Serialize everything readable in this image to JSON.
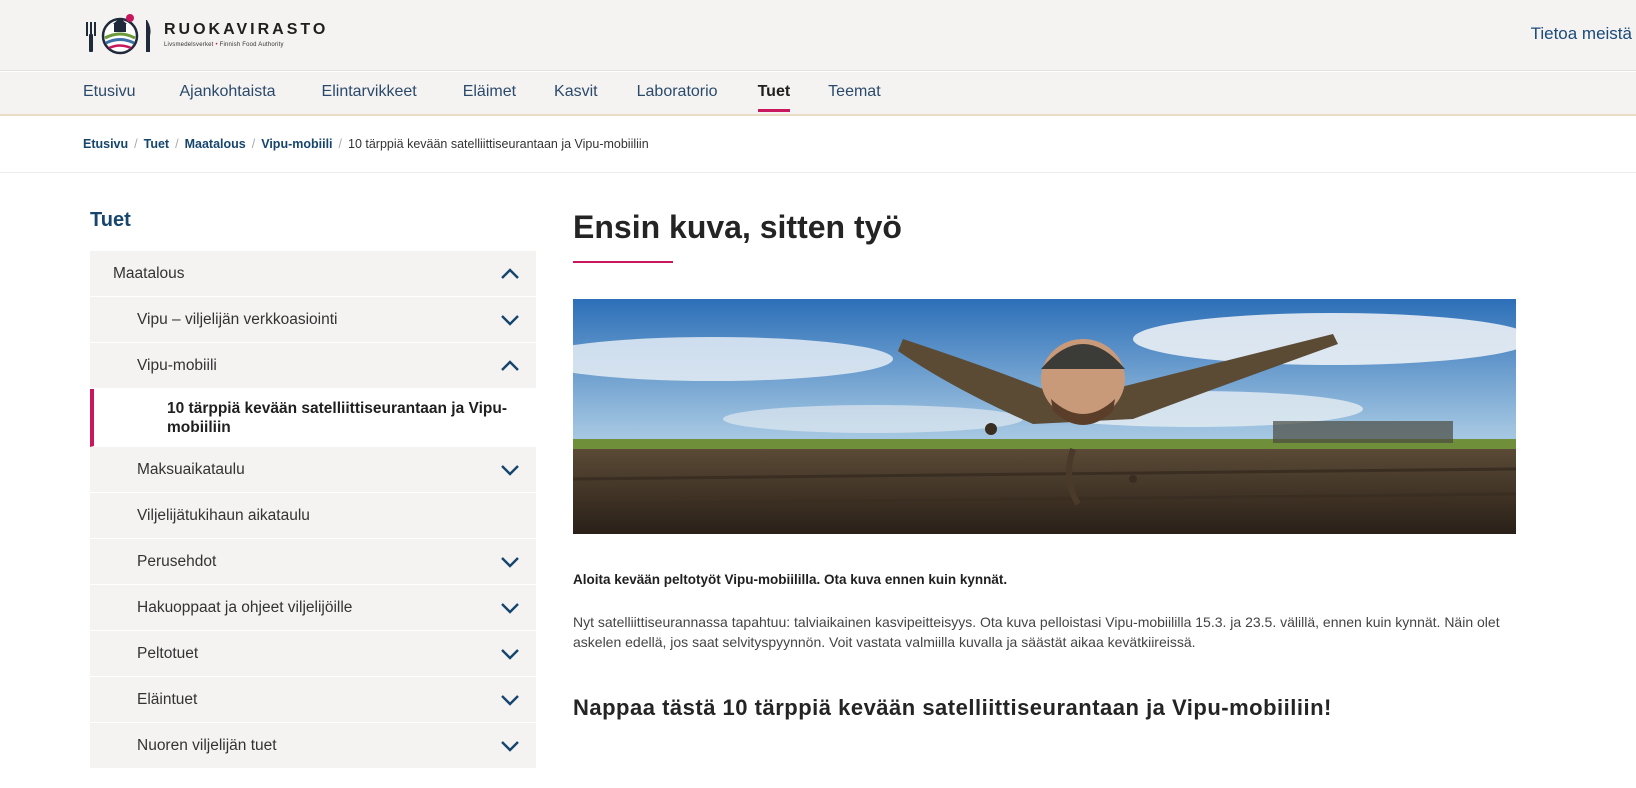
{
  "header": {
    "logo_name": "RUOKAVIRASTO",
    "logo_sub_a": "Livsmedelsverket",
    "logo_sub_b": "Finnish Food Authority",
    "top_link": "Tietoa meistä"
  },
  "nav": {
    "items": [
      {
        "label": "Etusivu",
        "active": false
      },
      {
        "label": "Ajankohtaista",
        "active": false
      },
      {
        "label": "Elintarvikkeet",
        "active": false
      },
      {
        "label": "Eläimet",
        "active": false
      },
      {
        "label": "Kasvit",
        "active": false
      },
      {
        "label": "Laboratorio",
        "active": false
      },
      {
        "label": "Tuet",
        "active": true
      },
      {
        "label": "Teemat",
        "active": false
      }
    ]
  },
  "breadcrumb": {
    "items": [
      "Etusivu",
      "Tuet",
      "Maatalous",
      "Vipu-mobiili"
    ],
    "current": "10 tärppiä kevään satelliittiseurantaan ja Vipu-mobiiliin"
  },
  "sidebar": {
    "title": "Tuet",
    "items": [
      {
        "label": "Maatalous",
        "level": 1,
        "toggle": "up"
      },
      {
        "label": "Vipu – viljelijän verkkoasiointi",
        "level": 2,
        "toggle": "down"
      },
      {
        "label": "Vipu-mobiili",
        "level": 2,
        "toggle": "up"
      },
      {
        "label": "10 tärppiä kevään satelliittiseurantaan ja Vipu-mobiiliin",
        "level": 3,
        "toggle": "none"
      },
      {
        "label": "Maksuaikataulu",
        "level": 2,
        "toggle": "down"
      },
      {
        "label": "Viljelijätukihaun aikataulu",
        "level": 2,
        "toggle": "none"
      },
      {
        "label": "Perusehdot",
        "level": 2,
        "toggle": "down"
      },
      {
        "label": "Hakuoppaat ja ohjeet viljelijöille",
        "level": 2,
        "toggle": "down"
      },
      {
        "label": "Peltotuet",
        "level": 2,
        "toggle": "down"
      },
      {
        "label": "Eläintuet",
        "level": 2,
        "toggle": "down"
      },
      {
        "label": "Nuoren viljelijän tuet",
        "level": 2,
        "toggle": "down"
      }
    ]
  },
  "article": {
    "title": "Ensin kuva, sitten työ",
    "lead": "Aloita kevään peltotyöt Vipu-mobiililla. Ota kuva ennen kuin kynnät.",
    "body": "Nyt satelliittiseurannassa tapahtuu: talviaikainen kasvipeitteisyys. Ota kuva pelloistasi Vipu-mobiililla 15.3. ja 23.5. välillä, ennen kuin kynnät. Näin olet askelen edellä, jos saat selvityspyynnön. Voit vastata valmiilla kuvalla ja säästät aikaa kevätkiireissä.",
    "subheading": "Nappaa tästä 10 tärppiä kevään satelliittiseurantaan ja Vipu-mobiiliin!"
  },
  "colors": {
    "accent": "#c8175d",
    "link": "#16456e",
    "header_bg": "#f5f3f1"
  }
}
